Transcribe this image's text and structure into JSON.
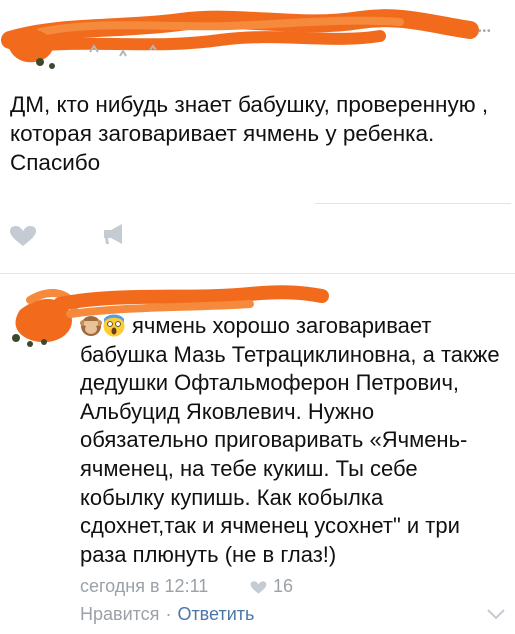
{
  "post": {
    "text": "ДМ, кто нибудь знает бабушку, проверенную , которая заговаривает ячмень у ребенка. Спасибо"
  },
  "post_actions": {
    "like_icon": "heart-icon",
    "share_icon": "megaphone-icon"
  },
  "comment": {
    "emoji": "see-no-evil-monkey, screaming-face",
    "text": "ячмень хорошо заговаривает бабушка Мазь Тетрациклиновна, а также дедушки Офтальмоферон Петрович, Альбуцид Яковлевич. Нужно обязательно приговаривать «Ячмень-ячменец, на тебе кукиш. Ты себе кобылку купишь. Как кобылка сдохнет,так и ячменец усохнет\" и три раза плюнуть (не в глаз!)",
    "time": "сегодня в 12:11",
    "likes": "16",
    "like_label": "Нравится",
    "separator": "·",
    "reply_label": "Ответить"
  },
  "colors": {
    "redaction": "#f26b1d",
    "meta": "#9aa1a8",
    "link": "#4a76a8",
    "icon": "#c5cbd2"
  }
}
